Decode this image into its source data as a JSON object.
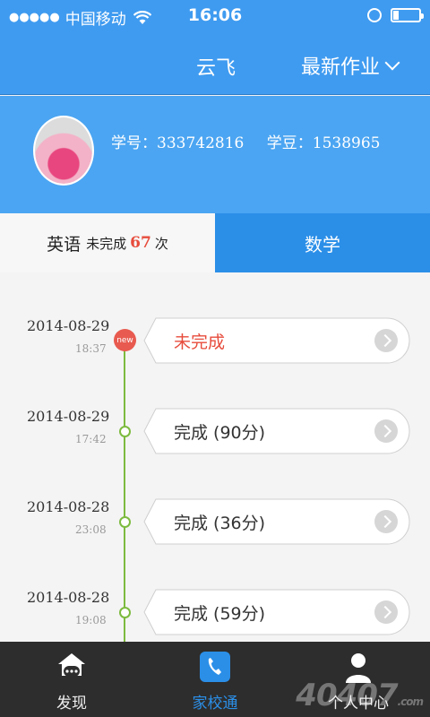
{
  "status_bar": {
    "signal": "●●●●●",
    "carrier": "中国移动",
    "time": "16:06"
  },
  "nav": {
    "title": "云飞",
    "dropdown_label": "最新作业"
  },
  "profile": {
    "student_id": "学号：333742816",
    "beans": "学豆：1538965"
  },
  "tabs": {
    "english": {
      "subject": "英语",
      "incomplete_label": "未完成",
      "incomplete_count": "67",
      "unit": "次"
    },
    "math": {
      "label": "数学"
    }
  },
  "timeline": [
    {
      "date": "2014-08-29",
      "time": "18:37",
      "status": "未完成",
      "badge": "new"
    },
    {
      "date": "2014-08-29",
      "time": "17:42",
      "status": "完成 (90分)"
    },
    {
      "date": "2014-08-28",
      "time": "23:08",
      "status": "完成 (36分)"
    },
    {
      "date": "2014-08-28",
      "time": "19:08",
      "status": "完成 (59分)"
    }
  ],
  "tab_bar": {
    "items": [
      {
        "label": "发现",
        "icon": "chat-bubble-icon"
      },
      {
        "label": "家校通",
        "icon": "phone-icon"
      },
      {
        "label": "个人中心",
        "icon": "person-icon"
      }
    ],
    "watermark": "40407",
    "watermark_suffix": ".com"
  },
  "colors": {
    "primary": "#3f9bf0",
    "math_tab": "#2b8fe8",
    "incomplete": "#e74c3c",
    "timeline_green": "#7dbb3f"
  }
}
